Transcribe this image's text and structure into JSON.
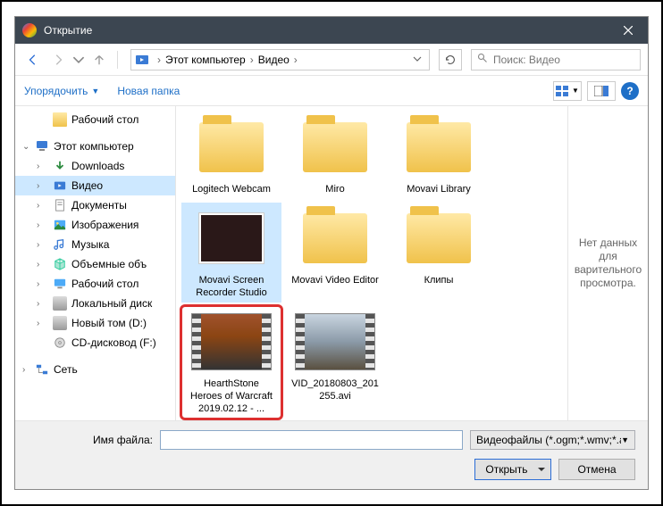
{
  "titlebar": {
    "title": "Открытие"
  },
  "breadcrumb": {
    "root": "Этот компьютер",
    "current": "Видео"
  },
  "search": {
    "placeholder": "Поиск: Видео"
  },
  "toolbar": {
    "organize": "Упорядочить",
    "new_folder": "Новая папка"
  },
  "sidebar": {
    "desktop": "Рабочий стол",
    "this_pc": "Этот компьютер",
    "downloads": "Downloads",
    "video": "Видео",
    "documents": "Документы",
    "pictures": "Изображения",
    "music": "Музыка",
    "volumes": "Объемные объ",
    "desktop2": "Рабочий стол",
    "local_disk": "Локальный диск",
    "new_vol": "Новый том (D:)",
    "cd": "CD-дисковод (F:)",
    "network": "Сеть"
  },
  "items": {
    "logitech": "Logitech Webcam",
    "miro": "Miro",
    "movavi_lib": "Movavi Library",
    "movavi_rec": "Movavi Screen Recorder Studio",
    "movavi_ve": "Movavi Video Editor",
    "clips": "Клипы",
    "hearth": "HearthStone Heroes of Warcraft 2019.02.12 - ...",
    "vid": "VID_20180803_201255.avi"
  },
  "preview": {
    "text": "Нет данных для варительного просмотра."
  },
  "footer": {
    "filename_label": "Имя файла:",
    "filetype": "Видеофайлы (*.ogm;*.wmv;*.a",
    "open": "Открыть",
    "cancel": "Отмена"
  }
}
